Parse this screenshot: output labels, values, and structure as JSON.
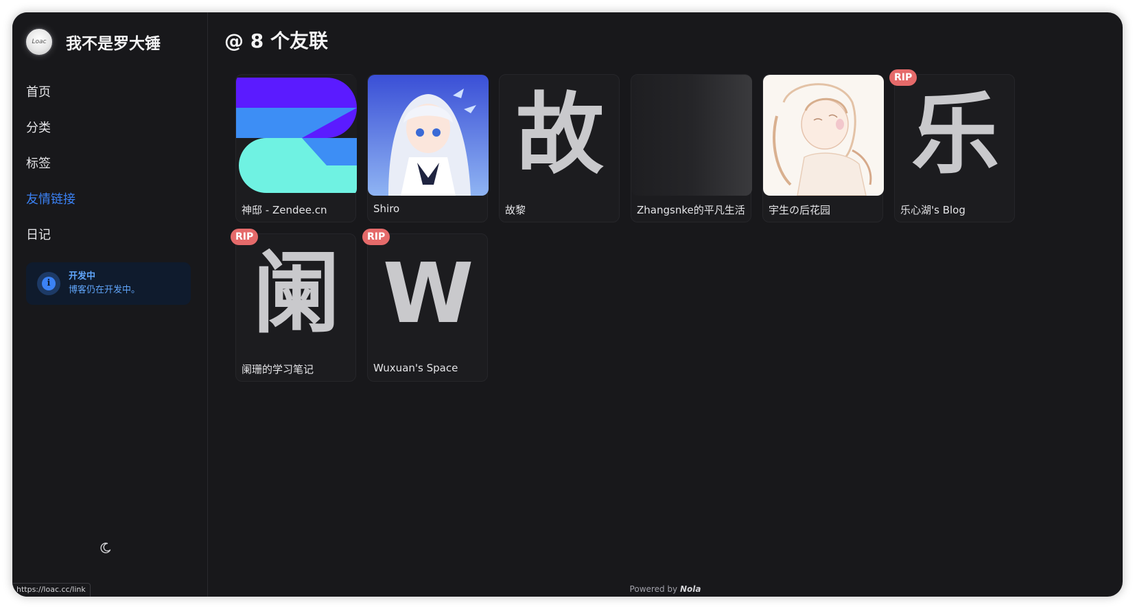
{
  "site": {
    "title": "我不是罗大锤",
    "avatar_text": "Loac"
  },
  "nav": [
    {
      "label": "首页",
      "active": false
    },
    {
      "label": "分类",
      "active": false
    },
    {
      "label": "标签",
      "active": false
    },
    {
      "label": "友情链接",
      "active": true
    },
    {
      "label": "日记",
      "active": false
    }
  ],
  "notice": {
    "title": "开发中",
    "body": "博客仍在开发中。",
    "icon": "info-icon"
  },
  "page": {
    "title": "@ 8 个友联"
  },
  "friends": [
    {
      "name": "神邸 - Zendee.cn",
      "thumb": "zendee-logo",
      "rip": false
    },
    {
      "name": "Shiro",
      "thumb": "anime-girl-image",
      "rip": false
    },
    {
      "name": "故黎",
      "thumb_char": "故",
      "rip": false
    },
    {
      "name": "Zhangsnke的平凡生活",
      "thumb": "gradient-placeholder",
      "rip": false
    },
    {
      "name": "宇生の后花园",
      "thumb": "sketch-girl-image",
      "rip": false
    },
    {
      "name": "乐心湖's Blog",
      "thumb_char": "乐",
      "rip": true
    },
    {
      "name": "阑珊的学习笔记",
      "thumb_char": "阑",
      "rip": true
    },
    {
      "name": "Wuxuan's Space",
      "thumb_char": "W",
      "rip": true
    }
  ],
  "rip_label": "RIP",
  "footer": {
    "prefix": "Powered by",
    "brand": "Nola"
  },
  "statusbar": {
    "url": "https://loac.cc/link"
  },
  "theme_toggle_icon": "moon-icon"
}
